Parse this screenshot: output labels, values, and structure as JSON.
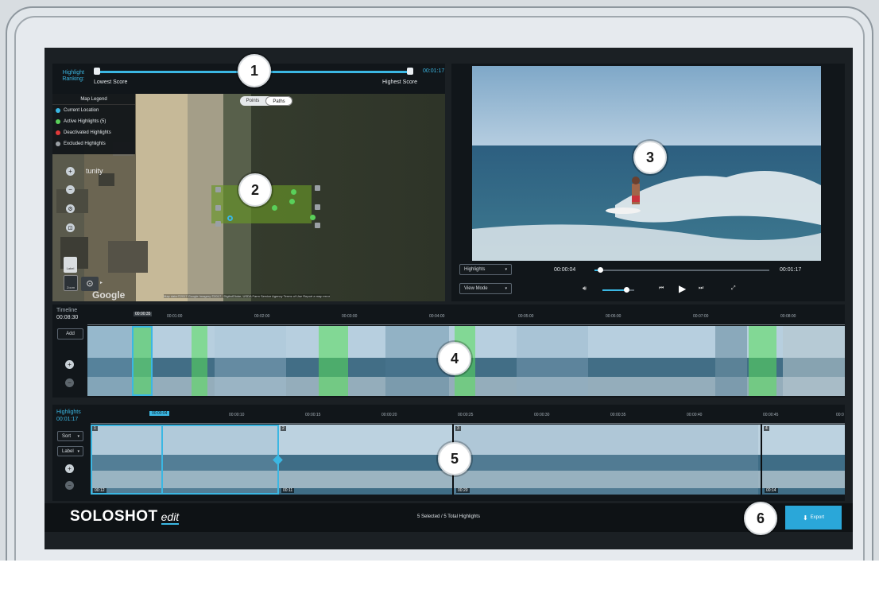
{
  "ranking": {
    "label_line1": "Highlight",
    "label_line2": "Ranking:",
    "lowest": "Lowest Score",
    "highest": "Highest Score",
    "time": "00:01:17"
  },
  "map": {
    "legend_title": "Map Legend",
    "legend_items": [
      {
        "label": "Current Location",
        "color": "#3bb7e3"
      },
      {
        "label": "Active Highlights (5)",
        "color": "#5ad05a"
      },
      {
        "label": "Deactivated Highlights",
        "color": "#e03a3a"
      },
      {
        "label": "Excluded Highlights",
        "color": "#9aa0a5"
      }
    ],
    "toggle_points": "Points",
    "toggle_paths": "Paths",
    "label_btn": "Label",
    "zoom_btn": "Zoom",
    "attribution": "Map data ©2017 Google Imagery ©2017 , DigitalGlobe, USDA Farm Service Agency   Terms of Use   Report a map error",
    "google": "Google",
    "map_text": "tunity"
  },
  "video": {
    "highlights_dropdown": "Highlights",
    "view_mode_dropdown": "View Mode",
    "current_time": "00:00:04",
    "total_time": "00:01:17",
    "progress": 0.03,
    "volume": 0.75
  },
  "timeline": {
    "title": "Timeline",
    "duration": "00:08:30",
    "add_btn": "Add",
    "playhead_label": "00:00:35",
    "ticks": [
      "00:01:00",
      "00:02:00",
      "00:03:00",
      "00:04:00",
      "00:05:00",
      "00:06:00",
      "00:07:00",
      "00:08:00"
    ]
  },
  "highlights": {
    "title": "Highlights",
    "duration": "00:01:17",
    "sort_btn": "Sort",
    "label_btn": "Label",
    "playhead_label": "00:00:04",
    "ticks": [
      "00:00:10",
      "00:00:15",
      "00:00:20",
      "00:00:25",
      "00:00:30",
      "00:00:35",
      "00:00:40",
      "00:00:45",
      "00:0"
    ],
    "clips": [
      {
        "num": "1",
        "dur": "00:12"
      },
      {
        "num": "2",
        "dur": "00:11"
      },
      {
        "num": "3",
        "dur": "00:20"
      },
      {
        "num": "4",
        "dur": "00:14"
      }
    ]
  },
  "footer": {
    "brand_main": "SOLOSHOT",
    "brand_edit": "edit",
    "status": "5 Selected / 5 Total Highlights",
    "export_btn": "Export"
  },
  "callouts": [
    "1",
    "2",
    "3",
    "4",
    "5",
    "6"
  ]
}
